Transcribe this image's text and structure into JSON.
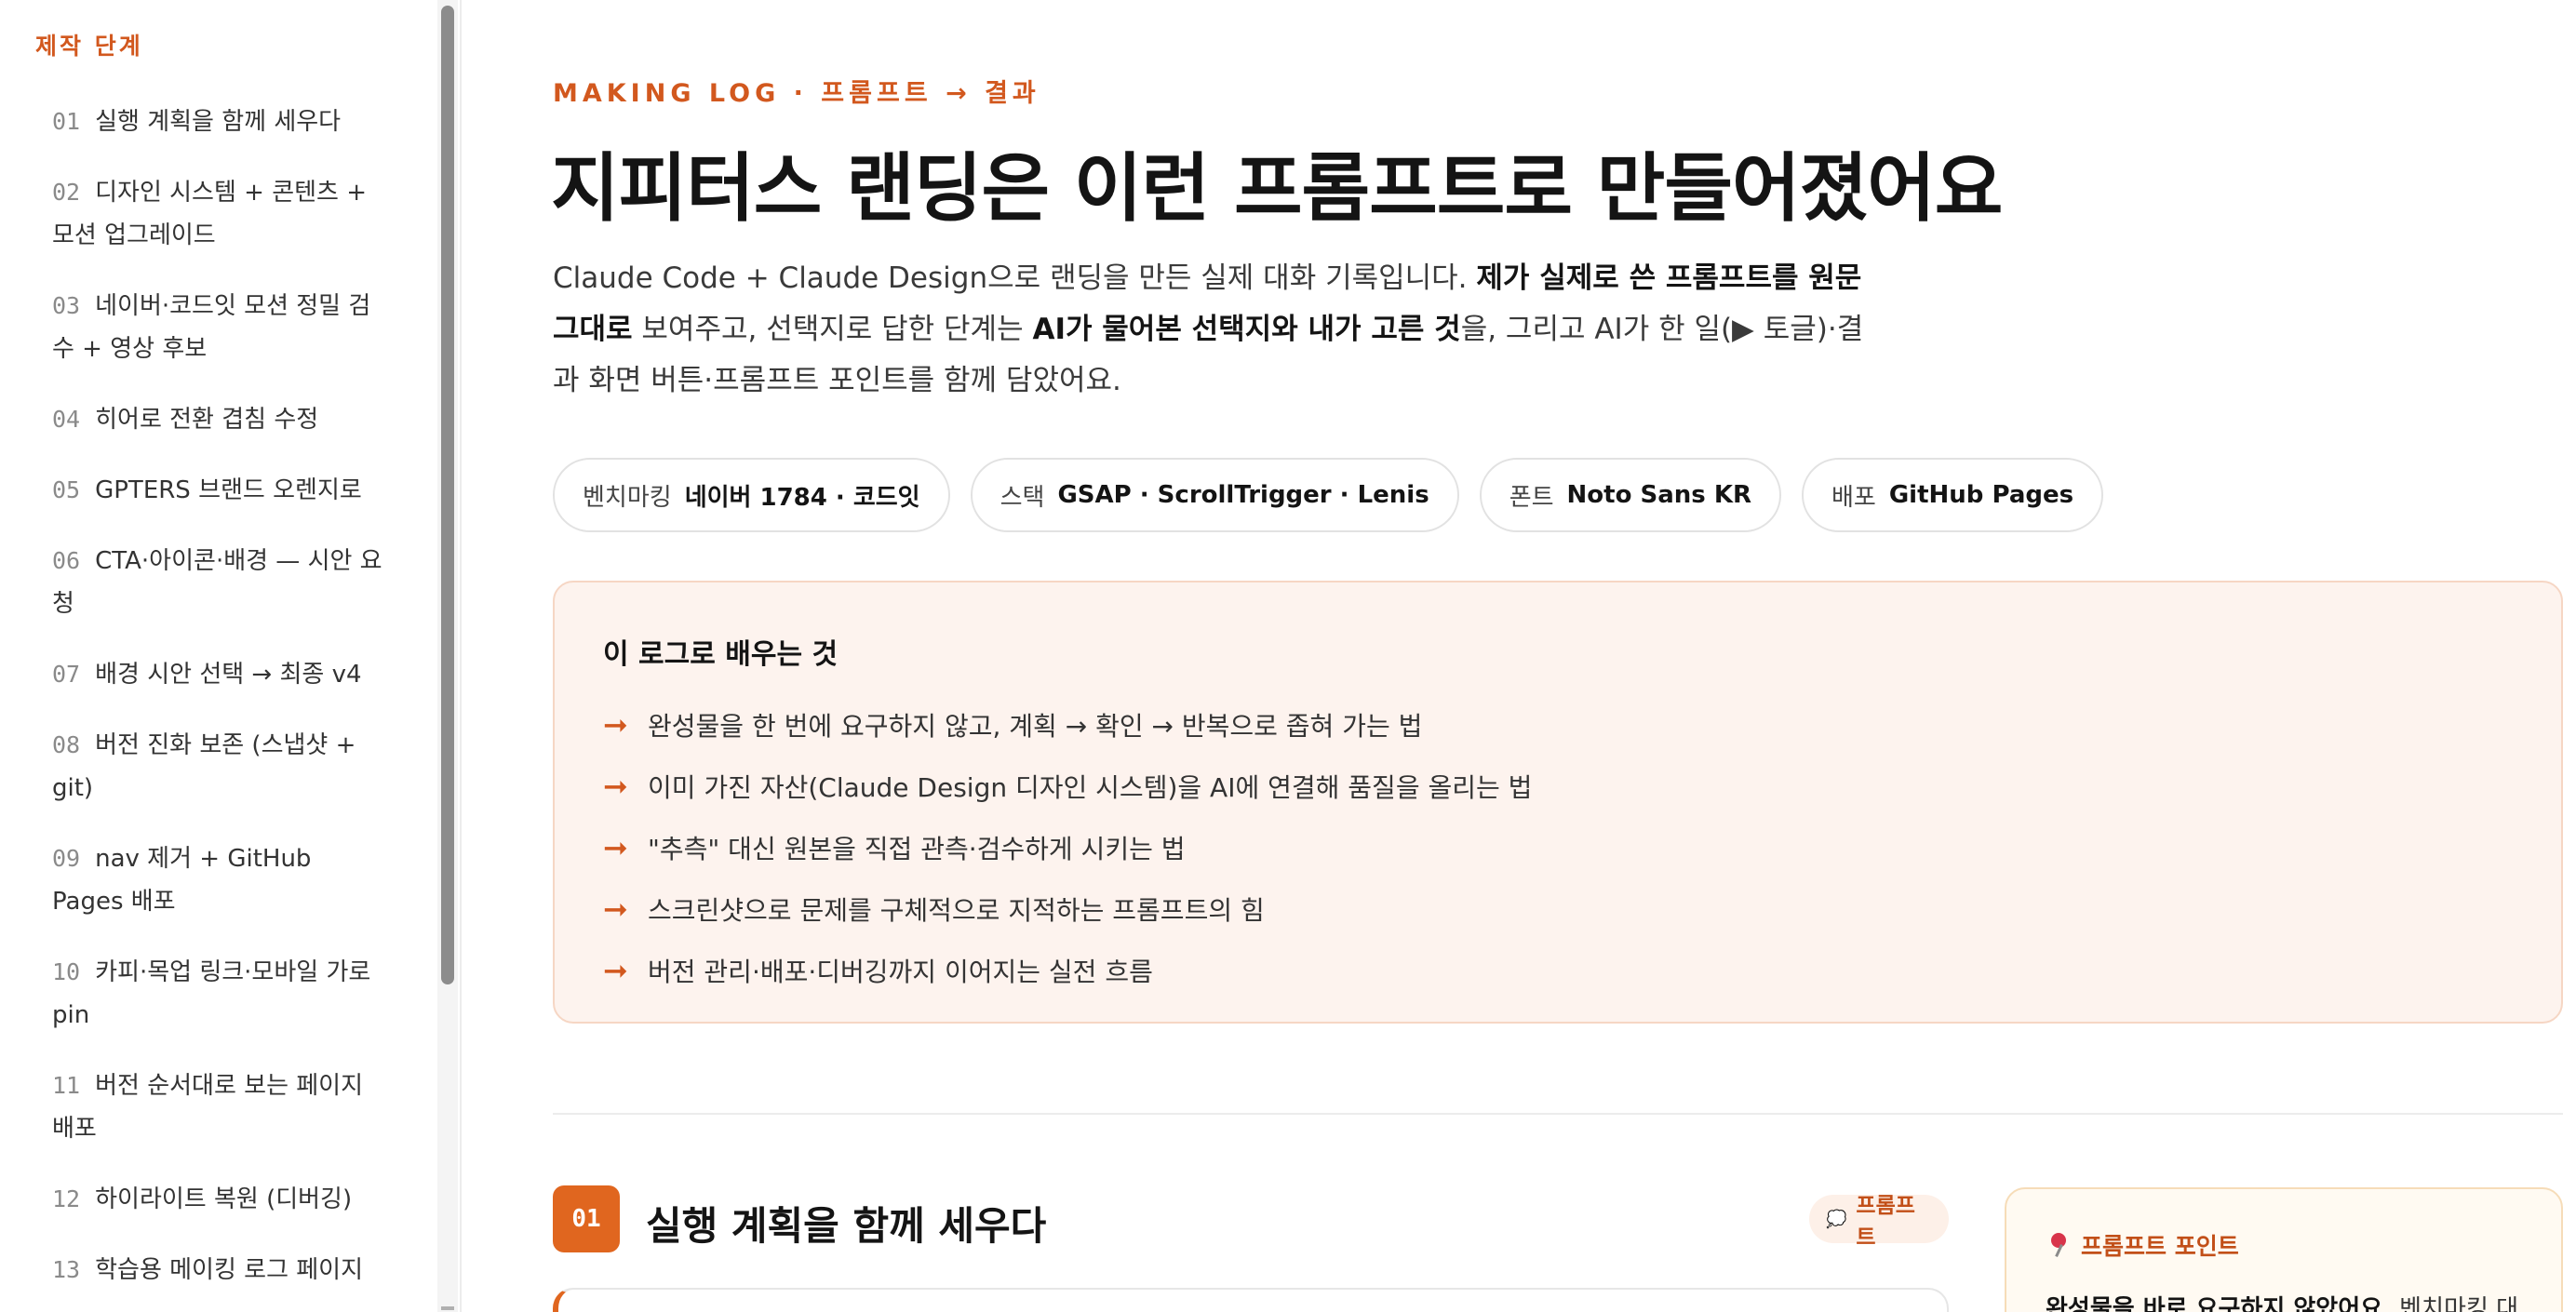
{
  "sidebar": {
    "heading": "제작 단계",
    "steps": [
      {
        "num": "01",
        "label": "실행 계획을 함께 세우다"
      },
      {
        "num": "02",
        "label": "디자인 시스템 + 콘텐츠 + 모션 업그레이드"
      },
      {
        "num": "03",
        "label": "네이버·코드잇 모션 정밀 검수 + 영상 후보"
      },
      {
        "num": "04",
        "label": "히어로 전환 겹침 수정"
      },
      {
        "num": "05",
        "label": "GPTERS 브랜드 오렌지로"
      },
      {
        "num": "06",
        "label": "CTA·아이콘·배경 — 시안 요청"
      },
      {
        "num": "07",
        "label": "배경 시안 선택 → 최종 v4"
      },
      {
        "num": "08",
        "label": "버전 진화 보존 (스냅샷 + git)"
      },
      {
        "num": "09",
        "label": "nav 제거 + GitHub Pages 배포"
      },
      {
        "num": "10",
        "label": "카피·목업 링크·모바일 가로 pin"
      },
      {
        "num": "11",
        "label": "버전 순서대로 보는 페이지 배포"
      },
      {
        "num": "12",
        "label": "하이라이트 복원 (디버깅)"
      },
      {
        "num": "13",
        "label": "학습용 메이킹 로그 페이지"
      }
    ]
  },
  "header": {
    "eyebrow": "MAKING LOG · 프롬프트 → 결과",
    "title": "지피터스 랜딩은 이런 프롬프트로 만들어졌어요",
    "intro": {
      "p1": "Claude Code + Claude Design으로 랜딩을 만든 실제 대화 기록입니다. ",
      "b1": "제가 실제로 쓴 프롬프트를 원문 그대로",
      "p2": " 보여주고, 선택지로 답한 단계는 ",
      "b2": "AI가 물어본 선택지와 내가 고른 것",
      "p3": "을, 그리고 AI가 한 일(▶ 토글)·결과 화면 버튼·프롬프트 포인트를 함께 담았어요."
    }
  },
  "chips": [
    {
      "key": "벤치마킹",
      "value": "네이버 1784 · 코드잇"
    },
    {
      "key": "스택",
      "value": "GSAP · ScrollTrigger · Lenis"
    },
    {
      "key": "폰트",
      "value": "Noto Sans KR"
    },
    {
      "key": "배포",
      "value": "GitHub Pages"
    }
  ],
  "learn": {
    "title": "이 로그로 배우는 것",
    "arrow": "➞",
    "items": [
      "완성물을 한 번에 요구하지 않고, 계획 → 확인 → 반복으로 좁혀 가는 법",
      "이미 가진 자산(Claude Design 디자인 시스템)을 AI에 연결해 품질을 올리는 법",
      "\"추측\" 대신 원본을 직접 관측·검수하게 시키는 법",
      "스크린샷으로 문제를 구체적으로 지적하는 프롬프트의 힘",
      "버전 관리·배포·디버깅까지 이어지는 실전 흐름"
    ]
  },
  "section": {
    "num": "01",
    "title": "실행 계획을 함께 세우다",
    "pill": "프롬프트",
    "bubble_icon": "speech-bubble-icon"
  },
  "tip": {
    "title": "프롬프트 포인트",
    "icon": "pushpin-icon",
    "bold": "완성물을 바로 요구하지 않았어요.",
    "text": " 벤치마킹 대"
  },
  "colors": {
    "accent": "#d2581e",
    "badge": "#e0661f",
    "learn_bg": "#fdf3ee",
    "tip_bg": "#fffaf2"
  }
}
